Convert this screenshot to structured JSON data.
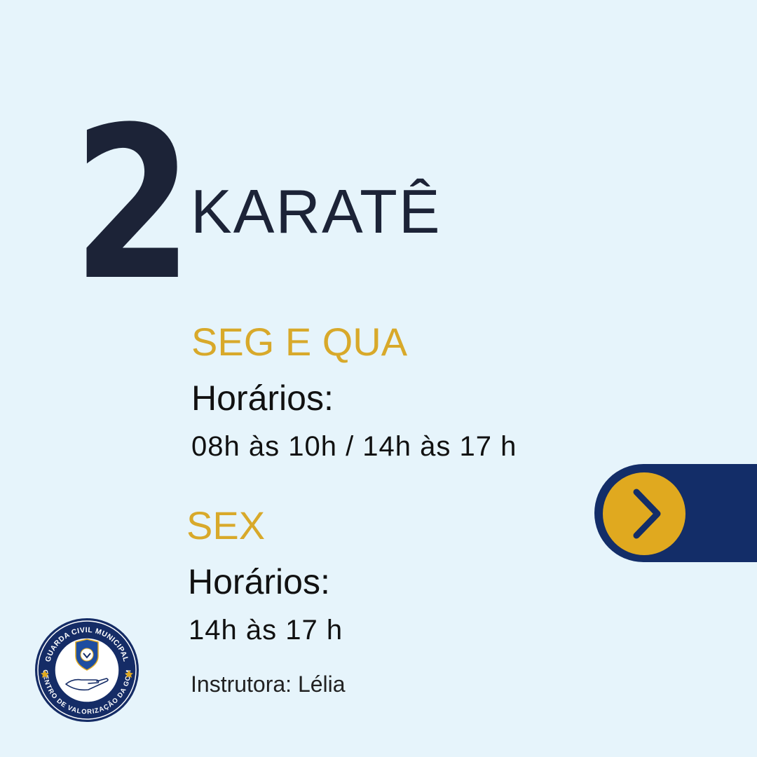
{
  "slide": {
    "number": "2",
    "activity": "KARATÊ"
  },
  "schedule": [
    {
      "days": "SEG E QUA",
      "hours_label": "Horários:",
      "hours": "08h às 10h / 14h às 17 h"
    },
    {
      "days": "SEX",
      "hours_label": "Horários:",
      "hours": "14h às 17 h"
    }
  ],
  "instructor": "Instrutora: Lélia",
  "logo": {
    "top_text": "GUARDA CIVIL MUNICIPAL",
    "bottom_text": "CENTRO DE VALORIZAÇÃO DA GCM",
    "icon": "shield-and-hand-emblem"
  },
  "next_button": {
    "icon": "chevron-right-icon"
  },
  "colors": {
    "background": "#e6f4fb",
    "navy": "#1c2337",
    "gold": "#d8a92a",
    "tab_blue": "#132d68",
    "button_gold": "#e0a91f"
  }
}
